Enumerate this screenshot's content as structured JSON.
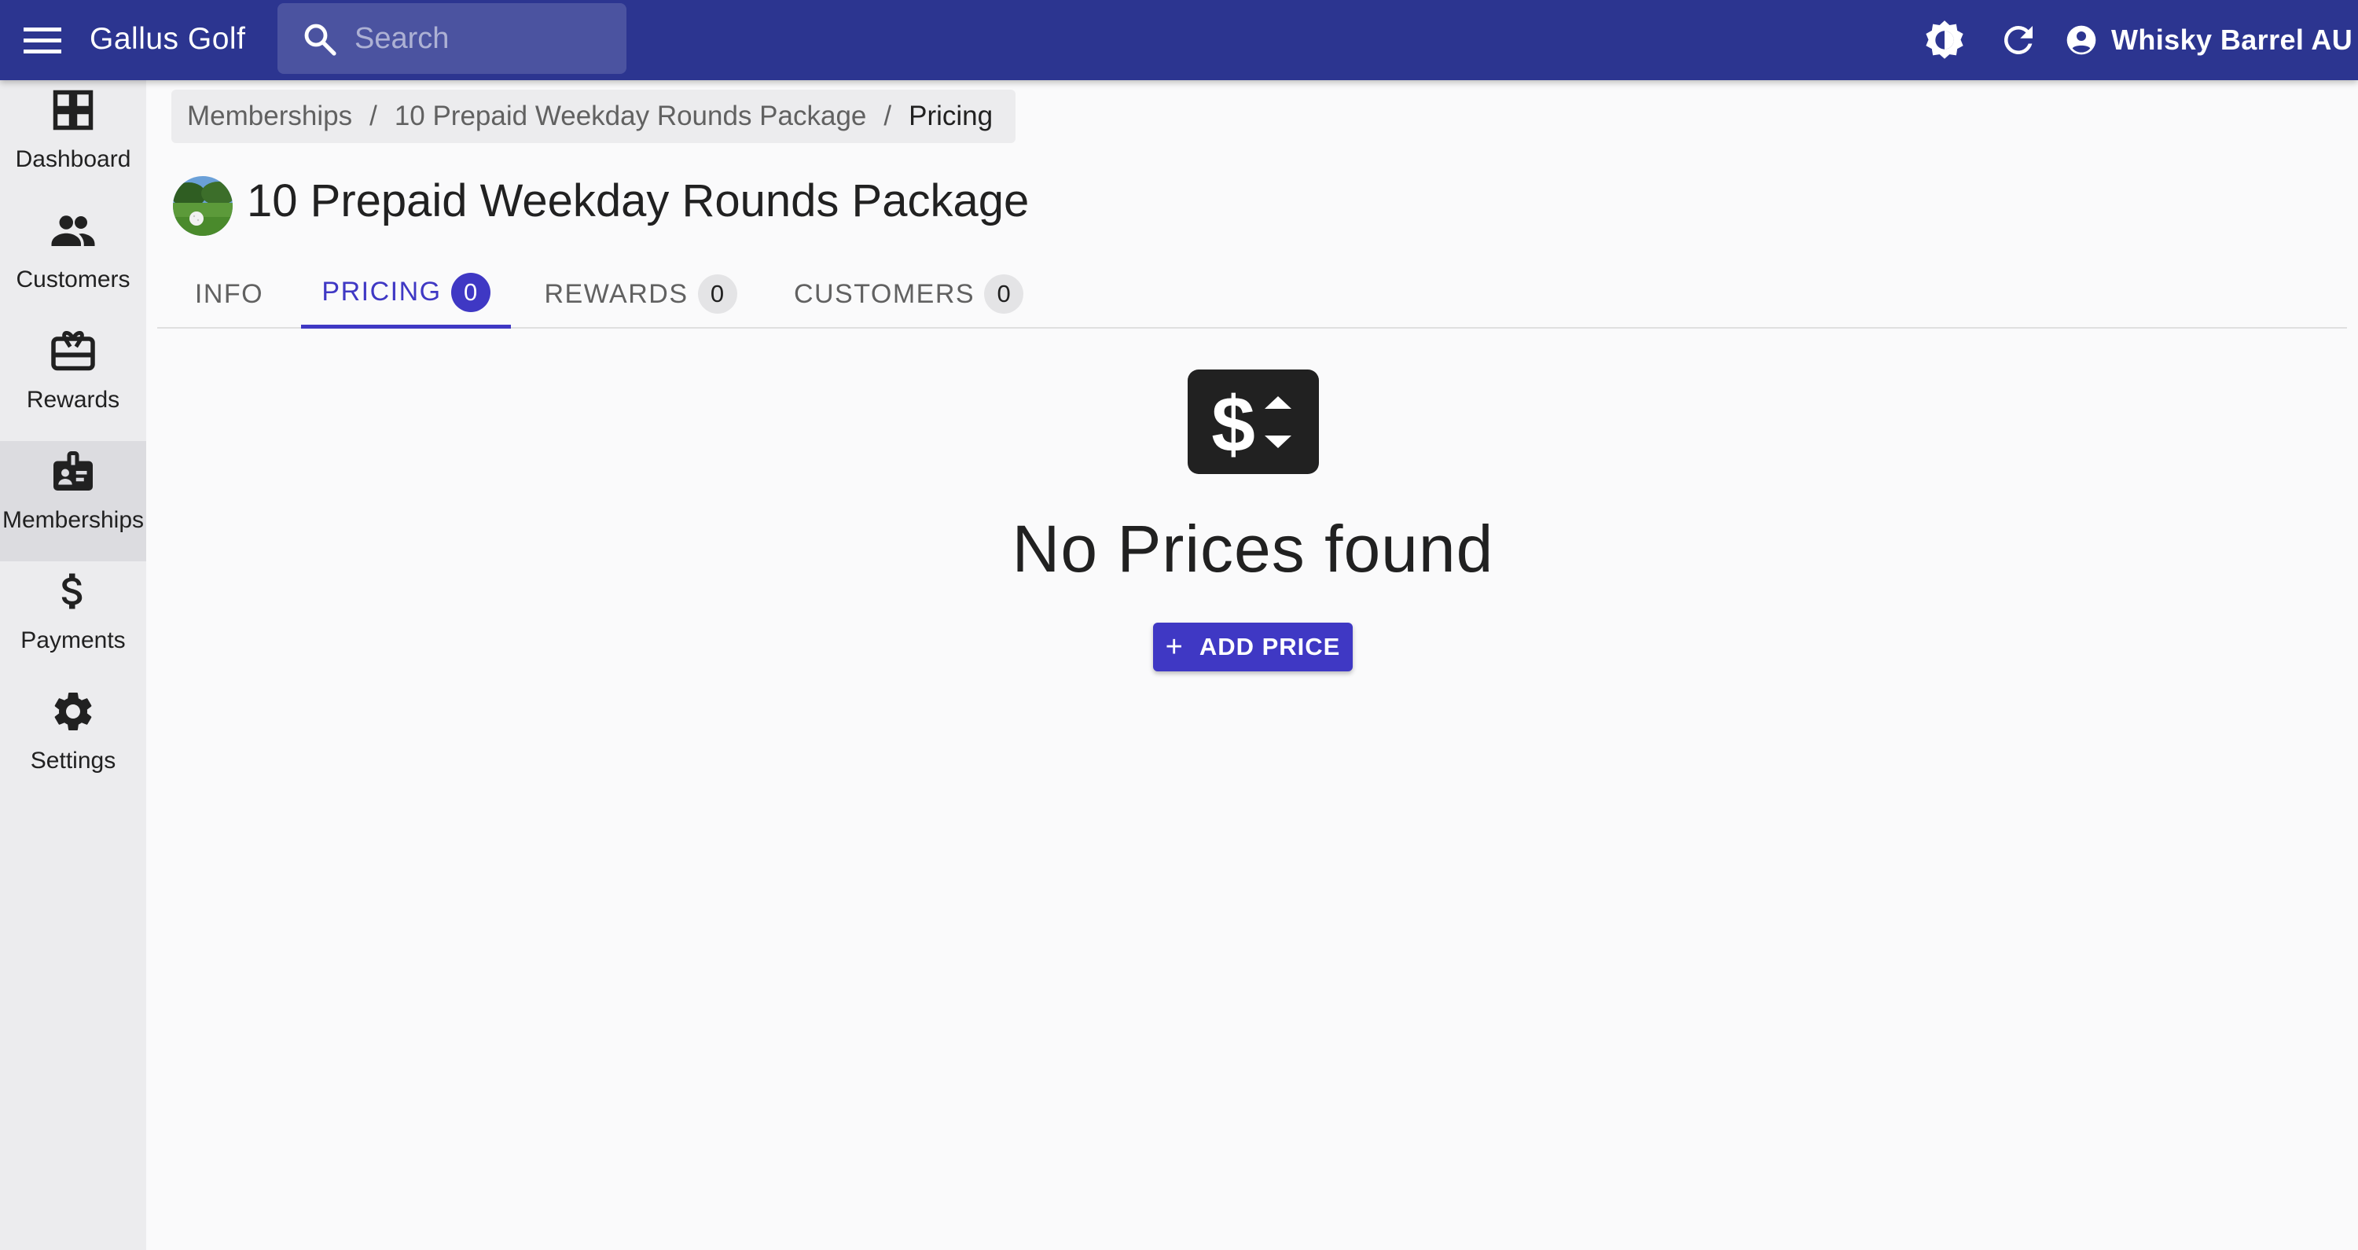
{
  "appbar": {
    "title": "Gallus Golf",
    "search_placeholder": "Search",
    "account_name": "Whisky Barrel AU",
    "icons": [
      "menu-icon",
      "search-icon",
      "brightness-icon",
      "refresh-icon",
      "account-circle-icon"
    ]
  },
  "sidebar": {
    "items": [
      {
        "label": "Dashboard",
        "icon": "dashboard-icon",
        "active": false
      },
      {
        "label": "Customers",
        "icon": "people-icon",
        "active": false
      },
      {
        "label": "Rewards",
        "icon": "gift-card-icon",
        "active": false
      },
      {
        "label": "Memberships",
        "icon": "badge-icon",
        "active": true
      },
      {
        "label": "Payments",
        "icon": "dollar-icon",
        "active": false
      },
      {
        "label": "Settings",
        "icon": "gear-icon",
        "active": false
      }
    ]
  },
  "breadcrumb": {
    "items": [
      "Memberships",
      "10 Prepaid Weekday Rounds Package"
    ],
    "current": "Pricing",
    "separator": "/"
  },
  "page": {
    "title": "10 Prepaid Weekday Rounds Package"
  },
  "tabs": [
    {
      "label": "INFO",
      "active": false
    },
    {
      "label": "PRICING",
      "count": "0",
      "active": true
    },
    {
      "label": "REWARDS",
      "count": "0",
      "active": false
    },
    {
      "label": "CUSTOMERS",
      "count": "0",
      "active": false
    }
  ],
  "empty_state": {
    "icon": "price-change-icon",
    "message": "No Prices found",
    "button_label": "ADD PRICE"
  },
  "colors": {
    "appbar": "#2c3590",
    "accent": "#3f38c4",
    "sidebar": "#ececee",
    "background": "#fafafb"
  }
}
